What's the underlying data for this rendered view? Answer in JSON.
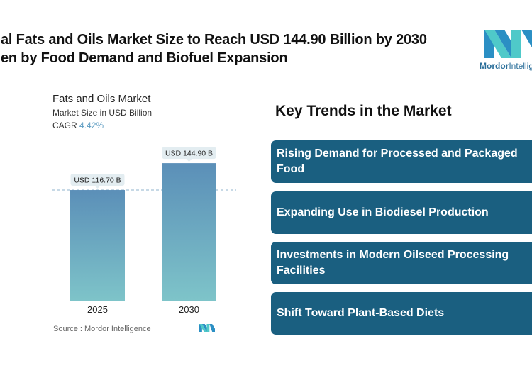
{
  "header": {
    "title_line1": "al Fats and Oils Market Size to Reach USD 144.90 Billion by 2030",
    "title_line2": "en by Food Demand and Biofuel Expansion",
    "logo_text_bold": "Mordor",
    "logo_text": "Intellige"
  },
  "chart_data": {
    "type": "bar",
    "title": "Fats and Oils Market",
    "subtitle": "Market Size in USD Billion",
    "cagr_label": "CAGR",
    "cagr_value": "4.42%",
    "categories": [
      "2025",
      "2030"
    ],
    "values": [
      116.7,
      144.9
    ],
    "data_labels": [
      "USD 116.70 B",
      "USD 144.90 B"
    ],
    "ylim": [
      0,
      150
    ],
    "reference_line": 116.7,
    "source": "Source :  Mordor Intelligence",
    "colors": {
      "bar_top": "#5b8fb8",
      "bar_bottom": "#7ec4c9",
      "label_bg": "#e3edf1"
    }
  },
  "trends": {
    "heading": "Key Trends in the Market",
    "items": [
      "Rising Demand for Processed and Packaged Food",
      "Expanding Use in Biodiesel Production",
      "Investments in Modern Oilseed Processing Facilities",
      "Shift Toward Plant-Based Diets"
    ]
  }
}
